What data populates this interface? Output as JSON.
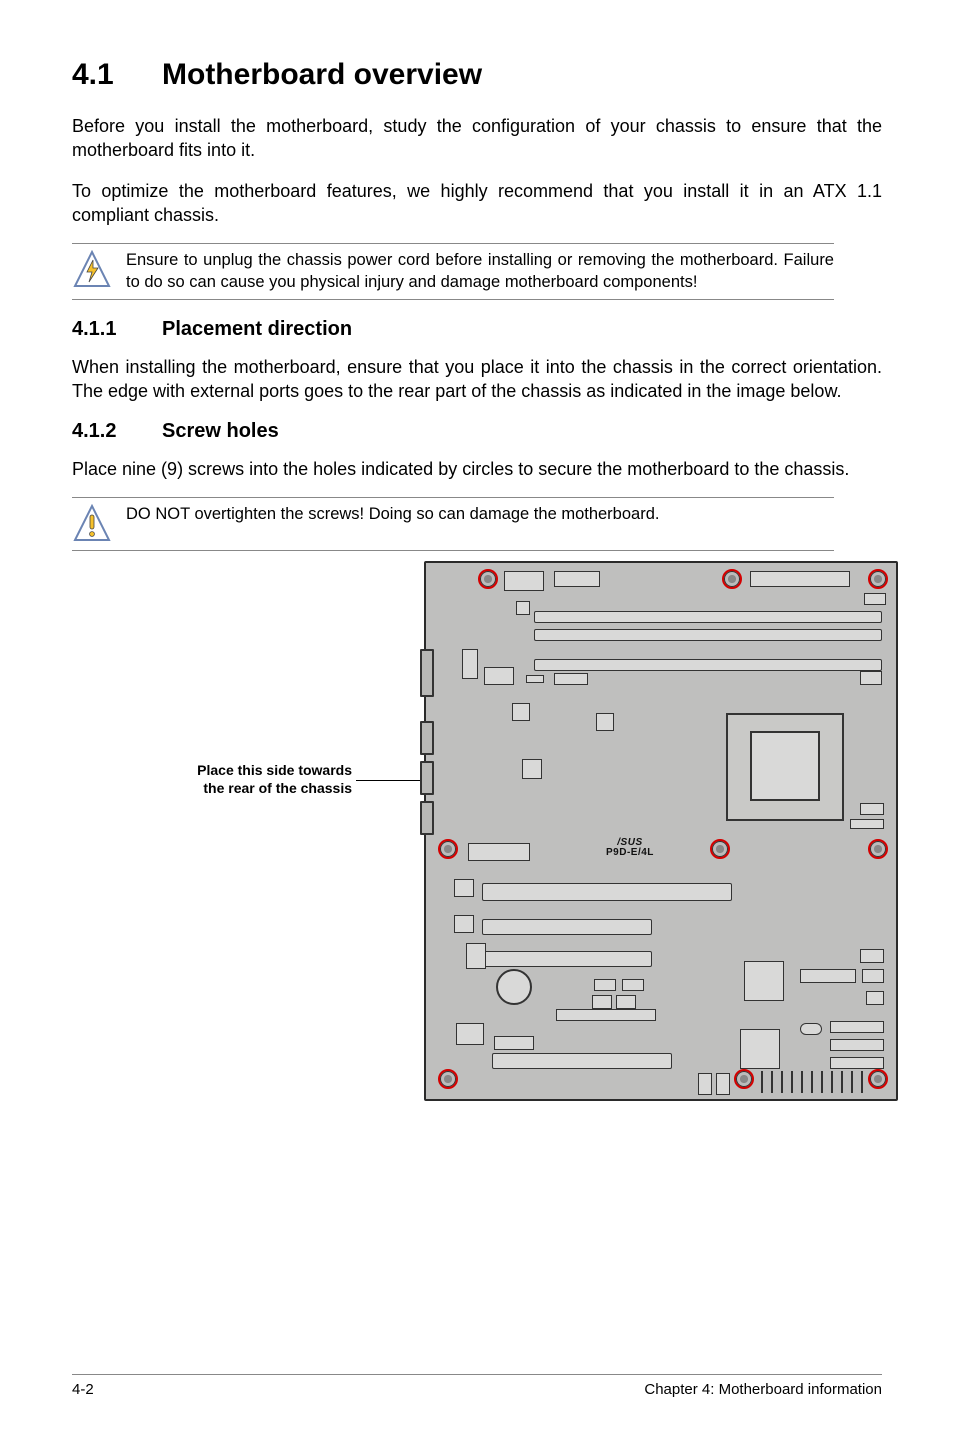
{
  "section": {
    "number": "4.1",
    "title": "Motherboard overview"
  },
  "paragraphs": {
    "p1": "Before you install the motherboard, study the configuration of your chassis to ensure that the motherboard fits into it.",
    "p2": "To optimize the motherboard features, we highly recommend that you install it in an ATX 1.1 compliant chassis."
  },
  "note1": "Ensure to unplug the chassis power cord before installing or removing the motherboard. Failure to do so can cause you physical injury and damage motherboard components!",
  "sub1": {
    "number": "4.1.1",
    "title": "Placement direction",
    "text": "When installing the motherboard, ensure that you place it into the chassis in the correct orientation. The edge with external ports goes to the rear part of the chassis as indicated in the image below."
  },
  "sub2": {
    "number": "4.1.2",
    "title": "Screw holes",
    "text": "Place nine (9) screws into the holes indicated by circles to secure the motherboard to the chassis."
  },
  "note2": "DO NOT overtighten the screws! Doing so can damage the motherboard.",
  "diagram": {
    "label_line1": "Place this side towards",
    "label_line2": "the rear of the chassis",
    "brand": "/SUS",
    "model": "P9D-E/4L"
  },
  "footer": {
    "left": "4-2",
    "right": "Chapter 4: Motherboard information"
  }
}
